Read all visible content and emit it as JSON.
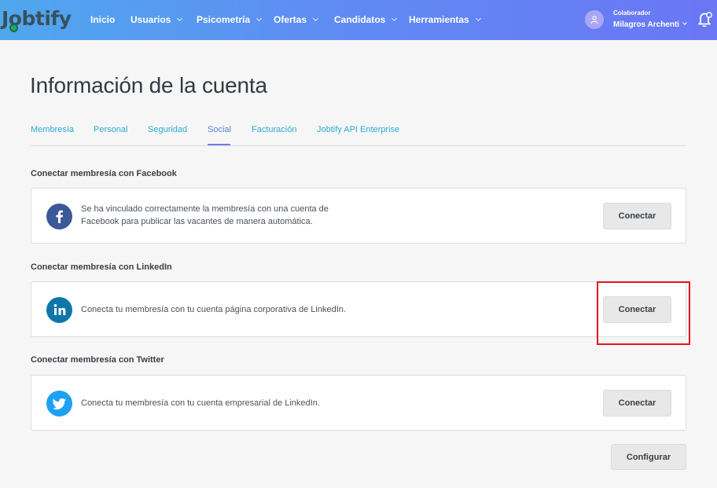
{
  "app": {
    "logo_text": "Jobtify"
  },
  "nav": {
    "items": [
      {
        "label": "Inicio",
        "has_dropdown": false
      },
      {
        "label": "Usuarios",
        "has_dropdown": true
      },
      {
        "label": "Psicometría",
        "has_dropdown": true
      },
      {
        "label": "Ofertas",
        "has_dropdown": true
      },
      {
        "label": "Candidatos",
        "has_dropdown": true
      },
      {
        "label": "Herramientas",
        "has_dropdown": true
      }
    ]
  },
  "user": {
    "role": "Colaborador",
    "name": "Milagros Archenti"
  },
  "page": {
    "title": "Información de la cuenta"
  },
  "tabs": [
    {
      "label": "Membresía",
      "active": false
    },
    {
      "label": "Personal",
      "active": false
    },
    {
      "label": "Seguridad",
      "active": false
    },
    {
      "label": "Social",
      "active": true
    },
    {
      "label": "Facturación",
      "active": false
    },
    {
      "label": "Jobtify API Enterprise",
      "active": false
    }
  ],
  "sections": {
    "facebook": {
      "title": "Conectar membresía con Facebook",
      "description_line1": "Se ha vinculado correctamente la membresía con una cuenta de",
      "description_line2": "Facebook para publicar las vacantes de manera automática.",
      "button": "Conectar",
      "icon": "facebook-icon",
      "color": "#3b5998"
    },
    "linkedin": {
      "title": "Conectar membresía con LinkedIn",
      "description": "Conecta tu membresía con tu cuenta página corporativa de LinkedIn.",
      "button": "Conectar",
      "icon": "linkedin-icon",
      "color": "#0e76a8"
    },
    "twitter": {
      "title": "Conectar membresía con Twitter",
      "description": "Conecta tu membresía con tu cuenta empresarial de LinkedIn.",
      "button": "Conectar",
      "icon": "twitter-icon",
      "color": "#1da1f2"
    }
  },
  "footer": {
    "configure_button": "Configurar"
  },
  "colors": {
    "accent": "#2cabd6",
    "active_tab_underline": "#6d7de8",
    "highlight": "#e3151d"
  }
}
